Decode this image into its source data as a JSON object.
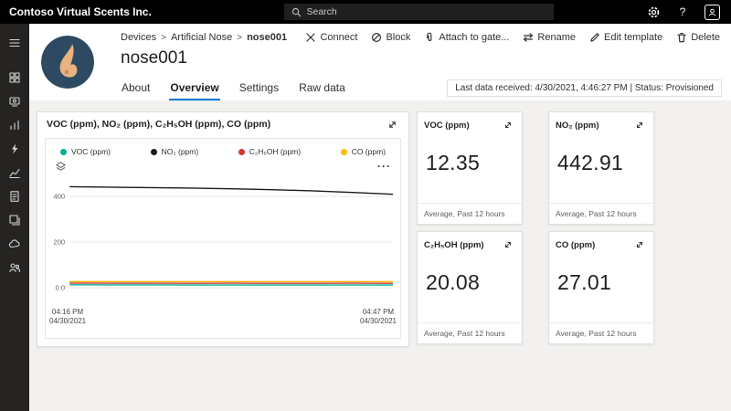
{
  "topbar": {
    "app_title": "Contoso Virtual Scents Inc.",
    "search_placeholder": "Search"
  },
  "sidebar": {
    "icons": [
      "menu-icon",
      "dashboard-icon",
      "devices-icon",
      "device-groups-icon",
      "rules-icon",
      "analytics-icon",
      "jobs-icon",
      "device-templates-icon",
      "data-export-icon",
      "administration-icon"
    ]
  },
  "breadcrumb": {
    "separator": ">",
    "items": [
      "Devices",
      "Artificial Nose",
      "nose001"
    ]
  },
  "device": {
    "name": "nose001",
    "status_line": "Last data received: 4/30/2021, 4:46:27 PM | Status: Provisioned"
  },
  "toolbar": {
    "items": [
      {
        "icon": "connect-icon",
        "label": "Connect"
      },
      {
        "icon": "block-icon",
        "label": "Block"
      },
      {
        "icon": "attach-icon",
        "label": "Attach to gate..."
      },
      {
        "icon": "rename-icon",
        "label": "Rename"
      },
      {
        "icon": "edit-icon",
        "label": "Edit template"
      },
      {
        "icon": "delete-icon",
        "label": "Delete"
      }
    ]
  },
  "tabs": [
    {
      "label": "About",
      "active": false
    },
    {
      "label": "Overview",
      "active": true
    },
    {
      "label": "Settings",
      "active": false
    },
    {
      "label": "Raw data",
      "active": false
    }
  ],
  "chart_card": {
    "title": "VOC (ppm), NO₂ (ppm), C₂H₅OH (ppm), CO (ppm)",
    "more_options": "···"
  },
  "chart_data": {
    "type": "line",
    "title": "VOC (ppm), NO₂ (ppm), C₂H₅OH (ppm), CO (ppm)",
    "legend_position": "top",
    "grid": true,
    "ylim": [
      -40,
      480
    ],
    "yticks": [
      {
        "value": 400,
        "label": "400"
      },
      {
        "value": 200,
        "label": "200"
      },
      {
        "value": 0,
        "label": "0.0"
      }
    ],
    "x_axis": {
      "start_time": "04:16 PM",
      "start_date": "04/30/2021",
      "end_time": "04:47 PM",
      "end_date": "04/30/2021"
    },
    "series": [
      {
        "name": "VOC (ppm)",
        "color": "#00b294",
        "values": [
          13.0,
          12.8,
          12.6,
          12.5,
          12.3,
          12.2,
          12.2,
          12.1,
          12.0
        ]
      },
      {
        "name": "NO₂ (ppm)",
        "color": "#1a1a1a",
        "values": [
          442,
          440,
          438,
          436,
          433,
          429,
          424,
          417,
          409
        ]
      },
      {
        "name": "C₂H₅OH (ppm)",
        "color": "#d13438",
        "values": [
          20.5,
          20.3,
          20.2,
          20.0,
          20.1,
          19.9,
          20.0,
          20.1,
          19.8
        ]
      },
      {
        "name": "CO (ppm)",
        "color": "#ffb900",
        "values": [
          27.5,
          27.2,
          27.0,
          27.1,
          26.9,
          27.0,
          27.1,
          26.8,
          27.0
        ]
      }
    ]
  },
  "tiles": [
    {
      "title": "VOC (ppm)",
      "value": "12.35",
      "footer": "Average, Past 12 hours"
    },
    {
      "title": "NO₂ (ppm)",
      "value": "442.91",
      "footer": "Average, Past 12 hours"
    },
    {
      "title": "C₂H₅OH (ppm)",
      "value": "20.08",
      "footer": "Average, Past 12 hours"
    },
    {
      "title": "CO (ppm)",
      "value": "27.01",
      "footer": "Average, Past 12 hours"
    }
  ],
  "colors": {
    "accent": "#0078d4",
    "topbar_bg": "#000000",
    "sidebar_bg": "#252423",
    "avatar_bg": "#2d4a62",
    "avatar_nose": "#e8b37e"
  }
}
